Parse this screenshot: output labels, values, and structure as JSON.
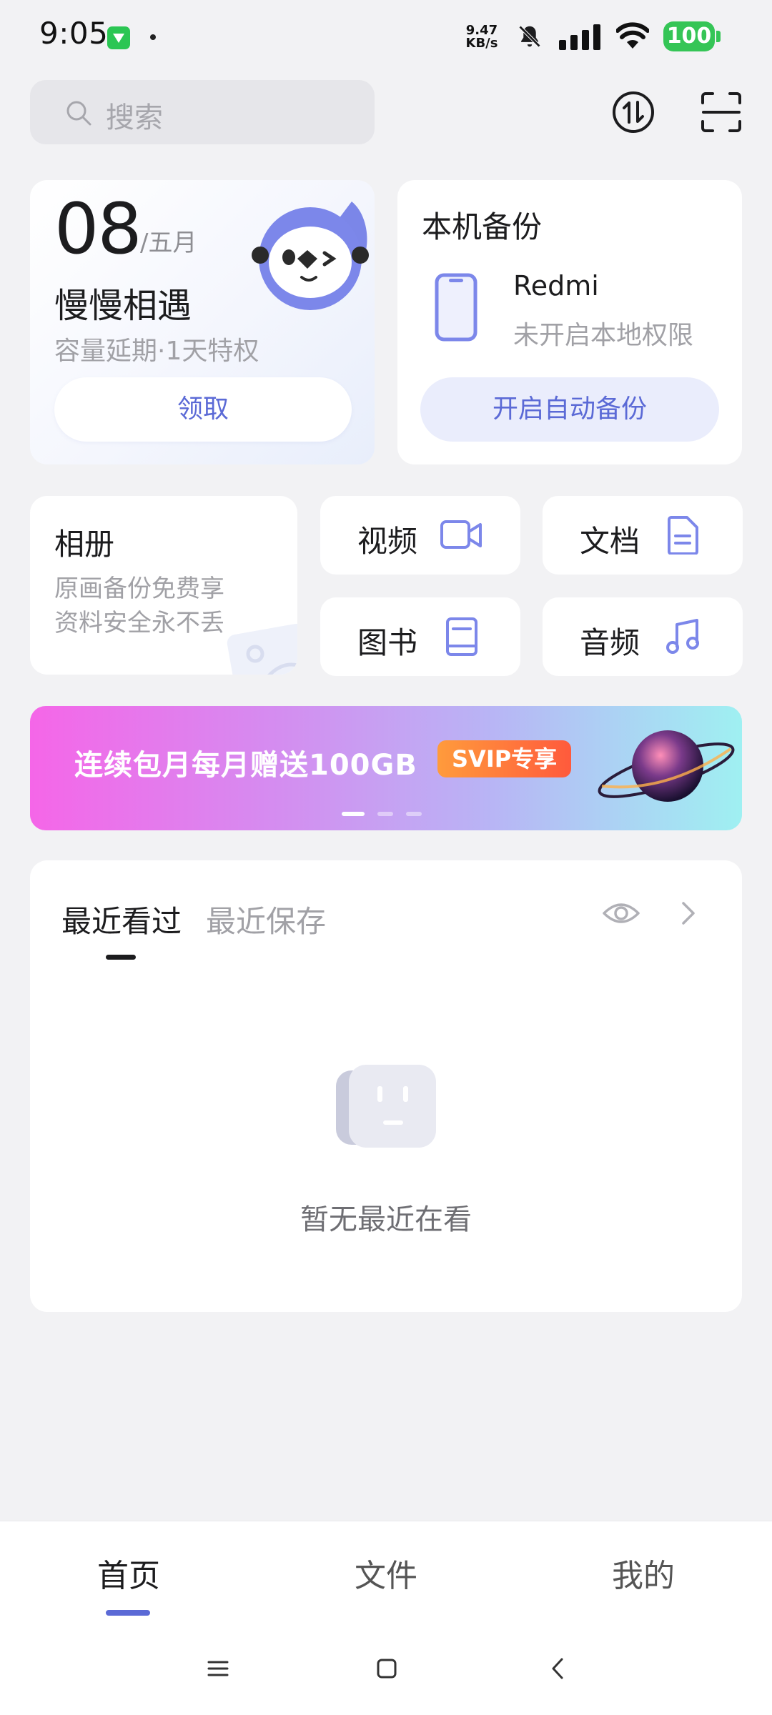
{
  "status_bar": {
    "time": "9:05",
    "net_speed_value": "9.47",
    "net_speed_unit": "KB/s",
    "battery": "100",
    "icons": [
      "app-notification-icon",
      "bell-mute-icon",
      "signal-icon",
      "wifi-icon",
      "battery-icon"
    ]
  },
  "search": {
    "placeholder": "搜索"
  },
  "top_icons": [
    "transfer-icon",
    "scan-icon"
  ],
  "date_card": {
    "day": "08",
    "month": "/五月",
    "title": "慢慢相遇",
    "subtitle": "容量延期·1天特权",
    "button": "领取"
  },
  "backup_card": {
    "title": "本机备份",
    "device_name": "Redmi",
    "device_status": "未开启本地权限",
    "button": "开启自动备份"
  },
  "album_card": {
    "title": "相册",
    "line1": "原画备份免费享",
    "line2": "资料安全永不丢"
  },
  "tiles": {
    "video": "视频",
    "document": "文档",
    "book": "图书",
    "audio": "音频"
  },
  "banner": {
    "text": "连续包月每月赠送100GB",
    "badge": "SVIP专享",
    "active_slide": 1,
    "slide_count": 3
  },
  "recent": {
    "tab_viewed": "最近看过",
    "tab_saved": "最近保存",
    "empty_text": "暂无最近在看"
  },
  "bottom_nav": {
    "home": "首页",
    "files": "文件",
    "mine": "我的"
  },
  "colors": {
    "accent": "#5b6ad6",
    "background": "#f2f2f4",
    "battery": "#35c556"
  }
}
